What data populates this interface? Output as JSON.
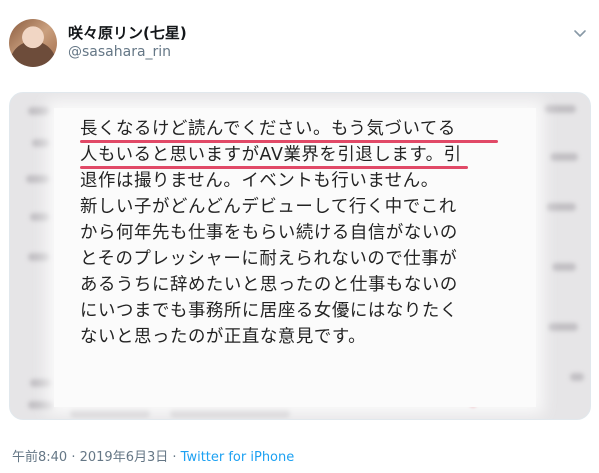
{
  "user": {
    "display_name": "咲々原リン(七星)",
    "handle": "@sasahara_rin",
    "avatar_icon": "avatar-photo"
  },
  "menu": {
    "icon": "chevron-down-icon"
  },
  "media": {
    "lines": [
      "長くなるけど読んでください。もう気づいてる",
      "人もいると思いますがAV業界を引退します。引",
      "退作は撮りません。イベントも行いません。",
      "新しい子がどんどんデビューして行く中でこれ",
      "から何年先も仕事をもらい続ける自信がないの",
      "とそのプレッシャーに耐えられないので仕事が",
      "あるうちに辞めたいと思ったのと仕事もないの",
      "にいつまでも事務所に居座る女優にはなりたく",
      "ないと思ったのが正直な意見です。"
    ],
    "highlight_color": "#e14967"
  },
  "footer": {
    "timestamp": "午前8:40",
    "separator": " · ",
    "date": "2019年6月3日",
    "source": "Twitter for iPhone"
  },
  "colors": {
    "secondary_text": "#657786",
    "link": "#1da1f2"
  }
}
